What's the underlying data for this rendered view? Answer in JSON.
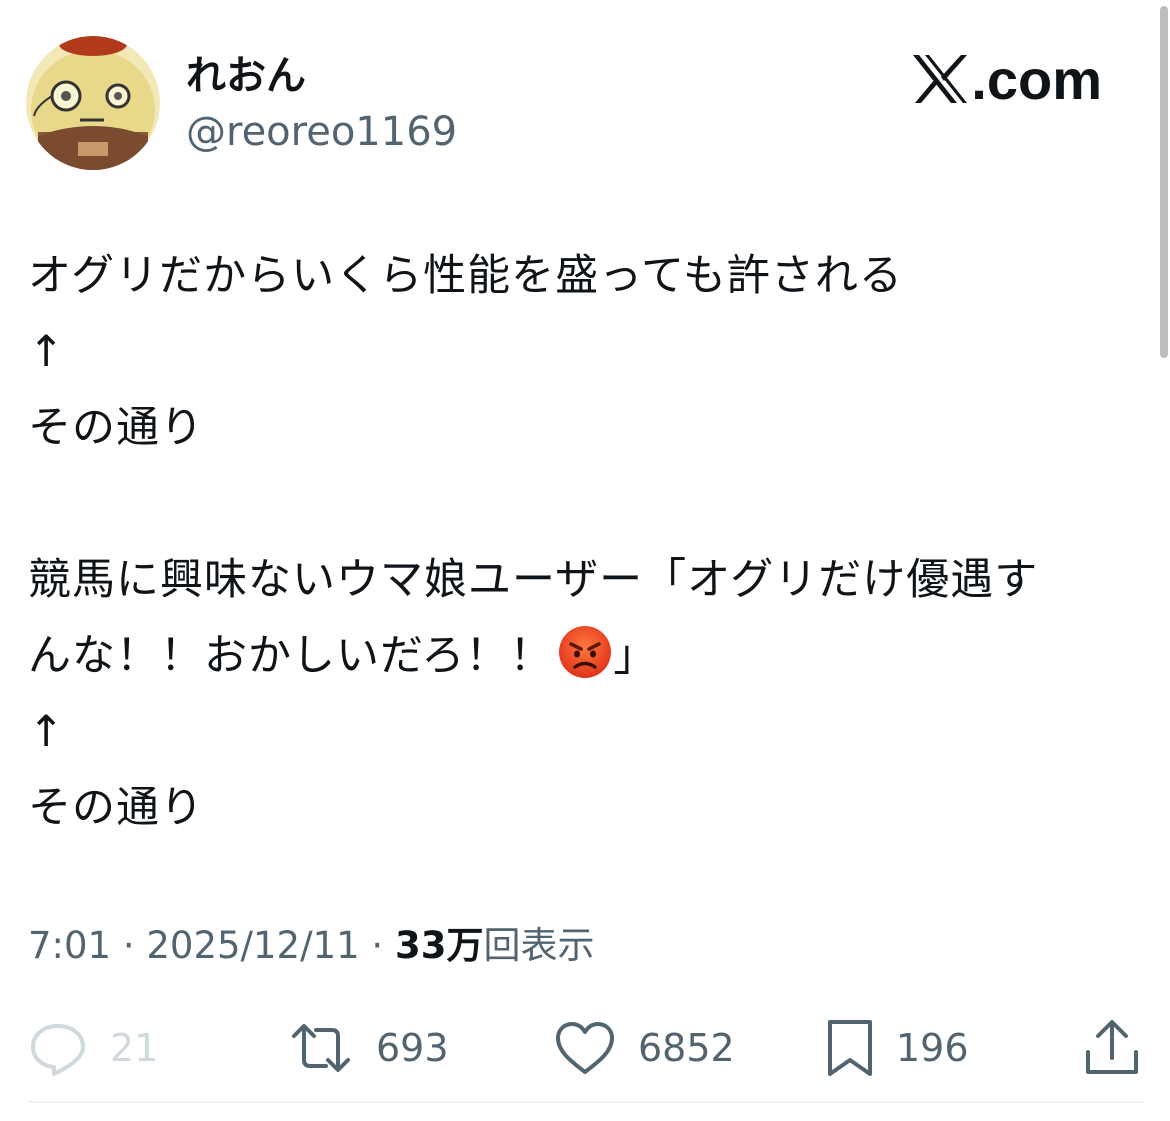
{
  "author": {
    "display_name": "れおん",
    "handle": "@reoreo1169"
  },
  "brand": {
    "label": ".com",
    "icon": "x-logo-icon"
  },
  "post": {
    "lines": [
      "オグリだからいくら性能を盛っても許される",
      "↑",
      "その通り",
      "",
      "競馬に興味ないウマ娘ユーザー「オグリだけ優遇す",
      "んな！！おかしいだろ！！",
      "↑",
      "その通り"
    ],
    "line6_end": "」",
    "emoji": "angry-face-icon"
  },
  "meta": {
    "time": "7:01",
    "separator": " · ",
    "date": "2025/12/11",
    "views_count": "33万",
    "views_label": "回表示"
  },
  "actions": {
    "replies": "21",
    "reposts": "693",
    "likes": "6852",
    "bookmarks": "196"
  },
  "colors": {
    "text": "#0f1419",
    "secondary": "#536471",
    "reply_muted": "#cfd9de",
    "divider": "#eff3f4"
  }
}
